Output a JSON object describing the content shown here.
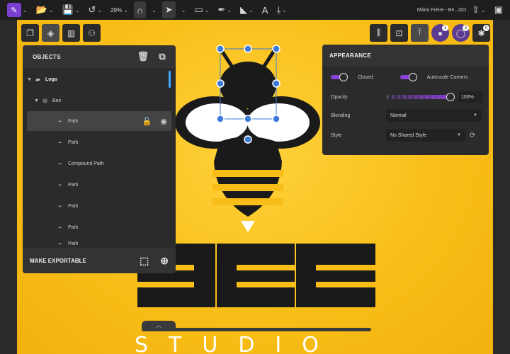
{
  "toolbar": {
    "zoom": "29%",
    "doc_title": "Mário Freire - Be...GO",
    "icons": [
      "app-logo-icon",
      "open-folder-icon",
      "save-icon",
      "undo-icon",
      "zoom-icon",
      "magnet-icon",
      "pointer-icon",
      "rectangle-icon",
      "pen-icon",
      "fill-icon",
      "text-icon",
      "import-icon",
      "share-icon",
      "window-icon"
    ]
  },
  "objects_panel": {
    "title": "OBJECTS",
    "rows": [
      {
        "label": "Logo",
        "indent": 0,
        "arrow": "▼",
        "glyph": "folder-icon"
      },
      {
        "label": "Bee",
        "indent": 1,
        "arrow": "▼",
        "glyph": "group-icon"
      },
      {
        "label": "Path",
        "indent": 2,
        "arrow": "",
        "glyph": "path-icon"
      },
      {
        "label": "Path",
        "indent": 2,
        "arrow": "",
        "glyph": "path-icon"
      },
      {
        "label": "Compound Path",
        "indent": 2,
        "arrow": "",
        "glyph": "path-icon"
      },
      {
        "label": "Path",
        "indent": 2,
        "arrow": "",
        "glyph": "path-icon"
      },
      {
        "label": "Path",
        "indent": 2,
        "arrow": "",
        "glyph": "path-icon"
      },
      {
        "label": "Path",
        "indent": 2,
        "arrow": "",
        "glyph": "path-icon"
      },
      {
        "label": "Path",
        "indent": 2,
        "arrow": "",
        "glyph": "path-icon"
      }
    ],
    "footer_label": "MAKE EXPORTABLE"
  },
  "appearance_panel": {
    "title": "APPEARANCE",
    "closed_label": "Closed",
    "autoscale_label": "Autoscale Corners",
    "opacity_label": "Opacity",
    "opacity_value": "100%",
    "blending_label": "Blending",
    "blending_value": "Normal",
    "style_label": "Style",
    "style_value": "No Shared Style"
  },
  "right_toolbar": {
    "badges": [
      "1",
      "2",
      "0"
    ]
  },
  "artwork": {
    "studio_text": "STUDIO",
    "colors": {
      "yellow": "#f8bd16",
      "black": "#1a1a1a",
      "white": "#ffffff",
      "accent": "#8a3fd6",
      "selection": "#3e7bd9"
    }
  }
}
